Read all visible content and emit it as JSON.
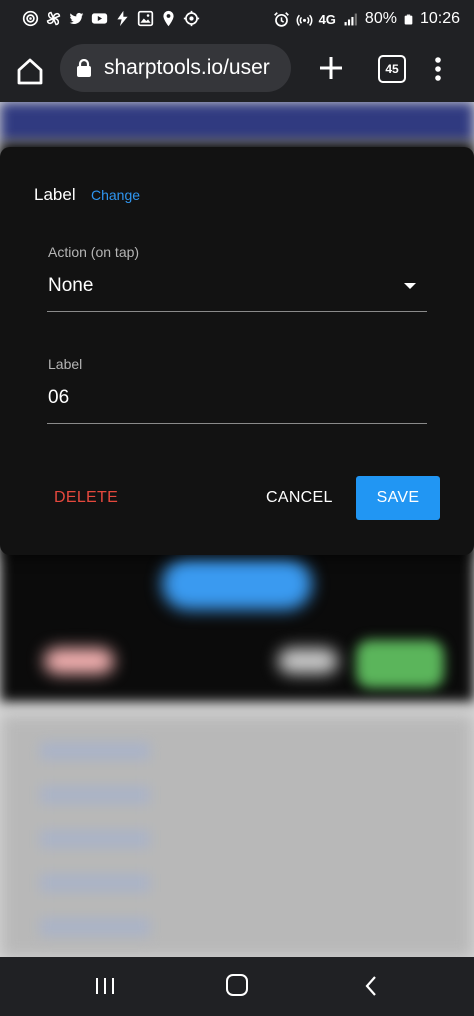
{
  "status_bar": {
    "left_icons": [
      "wifi-calling-icon",
      "pinwheel-icon",
      "twitter-icon",
      "youtube-icon",
      "bolt-icon",
      "image-icon",
      "location-pin-icon",
      "target-icon"
    ],
    "right_icons": [
      "alarm-icon",
      "hotspot-icon",
      "network-4g-icon",
      "signal-icon",
      "battery-icon"
    ],
    "network": "4G",
    "battery": "80%",
    "time": "10:26"
  },
  "browser": {
    "url": "sharptools.io/user",
    "tab_count": "45",
    "icons": [
      "home-icon",
      "lock-icon",
      "plus-icon",
      "tab-switcher-icon",
      "more-vert-icon"
    ]
  },
  "dialog": {
    "title": "Label",
    "change_link": "Change",
    "action_field": {
      "label": "Action (on tap)",
      "value": "None"
    },
    "label_field": {
      "label": "Label",
      "value": "06"
    },
    "buttons": {
      "delete": "DELETE",
      "cancel": "CANCEL",
      "save": "SAVE"
    }
  },
  "colors": {
    "accent": "#2196f3",
    "link": "#2f96f0",
    "danger": "#e5483d",
    "dialog_bg": "#121212"
  },
  "nav_bar": {
    "icons": [
      "recents-icon",
      "home-nav-icon",
      "back-icon"
    ]
  }
}
